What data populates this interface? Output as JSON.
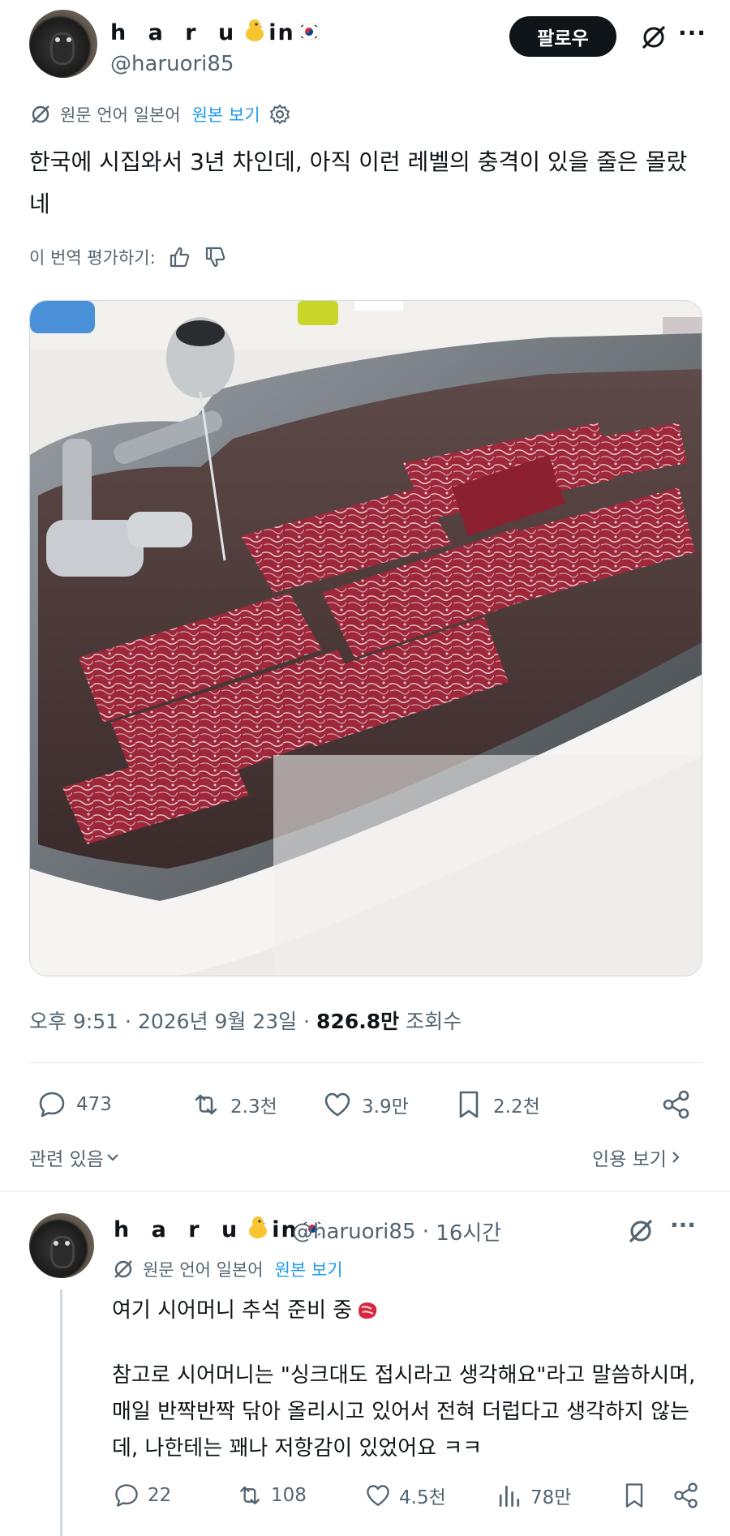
{
  "post": {
    "author_name": "h a r u",
    "author_suffix": "in",
    "handle": "@haruori85",
    "follow_label": "팔로우",
    "more_label": "···",
    "translation": {
      "note": "원문 언어 일본어",
      "show_original": "원본 보기"
    },
    "text": "한국에 시집와서 3년 차인데, 아직 이런 레벨의 충격이 있을 줄은 몰랐네",
    "rate_label": "이 번역 평가하기:",
    "time": "오후 9:51",
    "date": "2026년 9월 23일",
    "views_count": "826.8만",
    "views_label": "조회수",
    "stats": {
      "replies": "473",
      "reposts": "2.3천",
      "likes": "3.9만",
      "bookmarks": "2.2천"
    },
    "related_label": "관련 있음",
    "quotes_label": "인용 보기"
  },
  "reply": {
    "author_name": "h a r u",
    "author_suffix": "in",
    "handle": "@haruori85",
    "time_ago": "16시간",
    "more_label": "···",
    "translation": {
      "note": "원문 언어 일본어",
      "show_original": "원본 보기"
    },
    "line1": "여기 시어머니 추석 준비 중",
    "body": "참고로 시어머니는 \"싱크대도 접시라고 생각해요\"라고 말씀하시며, 매일 반짝반짝 닦아 올리시고 있어서 전혀 더럽다고 생각하지 않는데, 나한테는 꽤나 저항감이 있었어요 ㅋㅋ",
    "stats": {
      "replies": "22",
      "reposts": "108",
      "likes": "4.5천",
      "views": "78만"
    }
  },
  "icons": [
    "grok-icon",
    "more-icon",
    "translate-icon",
    "gear-icon",
    "thumbs-up-icon",
    "thumbs-down-icon",
    "reply-icon",
    "repost-icon",
    "like-icon",
    "bookmark-icon",
    "share-icon",
    "views-icon",
    "chevron-down-icon",
    "chevron-right-icon",
    "chick-emoji",
    "korea-flag-emoji",
    "meat-emoji"
  ],
  "colors": {
    "text": "#0f1419",
    "muted": "#536471",
    "accent": "#1d9bf0",
    "button": "#0f1419"
  }
}
